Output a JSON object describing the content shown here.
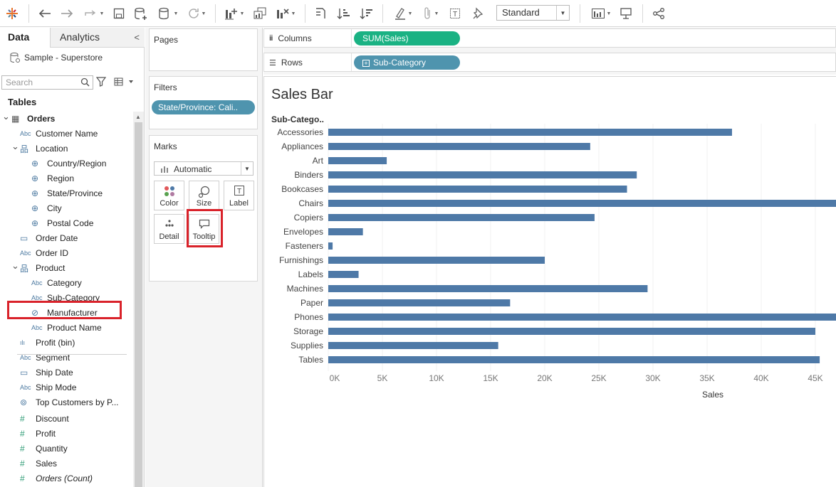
{
  "toolbar": {
    "standard_label": "Standard"
  },
  "data_pane": {
    "tab_data": "Data",
    "tab_analytics": "Analytics",
    "datasource": "Sample - Superstore",
    "search_placeholder": "Search",
    "tables_heading": "Tables",
    "fields": [
      {
        "label": "Orders",
        "type": "table"
      },
      {
        "label": "Customer Name",
        "type": "Abc"
      },
      {
        "label": "Location",
        "type": "hierarchy"
      },
      {
        "label": "Country/Region",
        "type": "geo"
      },
      {
        "label": "Region",
        "type": "geo"
      },
      {
        "label": "State/Province",
        "type": "geo"
      },
      {
        "label": "City",
        "type": "geo"
      },
      {
        "label": "Postal Code",
        "type": "geo"
      },
      {
        "label": "Order Date",
        "type": "date"
      },
      {
        "label": "Order ID",
        "type": "Abc"
      },
      {
        "label": "Product",
        "type": "hierarchy"
      },
      {
        "label": "Category",
        "type": "Abc"
      },
      {
        "label": "Sub-Category",
        "type": "Abc"
      },
      {
        "label": "Manufacturer",
        "type": "clip"
      },
      {
        "label": "Product Name",
        "type": "Abc"
      },
      {
        "label": "Profit (bin)",
        "type": "bin"
      },
      {
        "label": "Segment",
        "type": "Abc"
      },
      {
        "label": "Ship Date",
        "type": "date"
      },
      {
        "label": "Ship Mode",
        "type": "Abc"
      },
      {
        "label": "Top Customers by P...",
        "type": "set"
      },
      {
        "label": "Discount",
        "type": "measure"
      },
      {
        "label": "Profit",
        "type": "measure"
      },
      {
        "label": "Quantity",
        "type": "measure"
      },
      {
        "label": "Sales",
        "type": "measure"
      },
      {
        "label": "Orders (Count)",
        "type": "measure-italic"
      }
    ]
  },
  "cards": {
    "pages_title": "Pages",
    "filters_title": "Filters",
    "filter_pill": "State/Province: Cali..",
    "marks_title": "Marks",
    "mark_type": "Automatic",
    "mark_buttons": [
      "Color",
      "Size",
      "Label",
      "Detail",
      "Tooltip"
    ]
  },
  "shelves": {
    "columns_label": "Columns",
    "columns_pill": "SUM(Sales)",
    "rows_label": "Rows",
    "rows_pill": "Sub-Category"
  },
  "colors": {
    "bar": "#4e79a7",
    "measure_pill": "#1ab283",
    "dimension_pill": "#4f94ae",
    "highlight": "#d9222a"
  },
  "chart_data": {
    "type": "bar",
    "orientation": "horizontal",
    "title": "Sales Bar",
    "row_header": "Sub-Catego..",
    "xlabel": "Sales",
    "categories": [
      "Accessories",
      "Appliances",
      "Art",
      "Binders",
      "Bookcases",
      "Chairs",
      "Copiers",
      "Envelopes",
      "Fasteners",
      "Furnishings",
      "Labels",
      "Machines",
      "Paper",
      "Phones",
      "Storage",
      "Supplies",
      "Tables"
    ],
    "values": [
      37300,
      24200,
      5400,
      28500,
      27600,
      47500,
      24600,
      3200,
      400,
      20000,
      2800,
      29500,
      16800,
      47500,
      45000,
      15700,
      45400
    ],
    "ticks": [
      "0K",
      "5K",
      "10K",
      "15K",
      "20K",
      "25K",
      "30K",
      "35K",
      "40K",
      "45K"
    ],
    "tick_values": [
      0,
      5000,
      10000,
      15000,
      20000,
      25000,
      30000,
      35000,
      40000,
      45000
    ],
    "grid": true
  }
}
